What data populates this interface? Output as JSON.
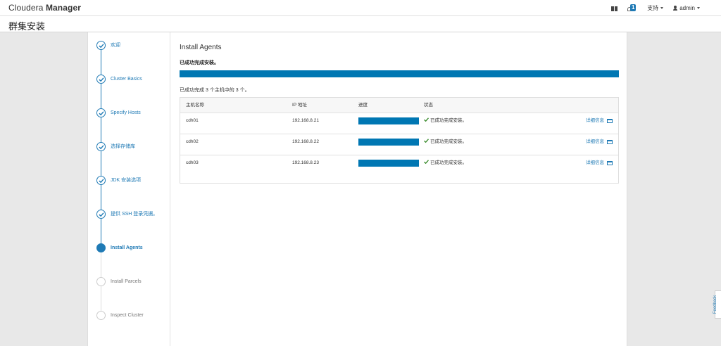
{
  "brand": {
    "name_light": "Cloudera ",
    "name_bold": "Manager"
  },
  "nav": {
    "gift_icon": "gift-icon",
    "notification_count": "1",
    "support_label": "支持",
    "user_label": "admin"
  },
  "page": {
    "title": "群集安装"
  },
  "steps": [
    {
      "label": "欢迎",
      "state": "done"
    },
    {
      "label": "Cluster Basics",
      "state": "done"
    },
    {
      "label": "Specify Hosts",
      "state": "done"
    },
    {
      "label": "选择存储库",
      "state": "done"
    },
    {
      "label": "JDK 安装选项",
      "state": "done"
    },
    {
      "label": "提供 SSH 登录凭据。",
      "state": "done"
    },
    {
      "label": "Install Agents",
      "state": "active"
    },
    {
      "label": "Install Parcels",
      "state": "pending"
    },
    {
      "label": "Inspect Cluster",
      "state": "pending"
    }
  ],
  "main": {
    "heading": "Install Agents",
    "success_message": "已成功完成安装。",
    "overall_progress": 1.0,
    "hosts_summary": "已成功完成 3 个主机中的 3 个。",
    "table": {
      "headers": {
        "host": "主机名称",
        "ip": "IP 地址",
        "progress": "进度",
        "status": "状态"
      },
      "rows": [
        {
          "host": "cdh01",
          "ip": "192.168.8.21",
          "progress": 1.0,
          "status": "已成功完成安装。",
          "detail": "详细信息"
        },
        {
          "host": "cdh02",
          "ip": "192.168.8.22",
          "progress": 1.0,
          "status": "已成功完成安装。",
          "detail": "详细信息"
        },
        {
          "host": "cdh03",
          "ip": "192.168.8.23",
          "progress": 1.0,
          "status": "已成功完成安装。",
          "detail": "详细信息"
        }
      ]
    }
  },
  "feedback_label": "Feedback",
  "colors": {
    "accent": "#1f7ab5",
    "progress": "#0077b3",
    "ok": "#3c8d2f"
  }
}
